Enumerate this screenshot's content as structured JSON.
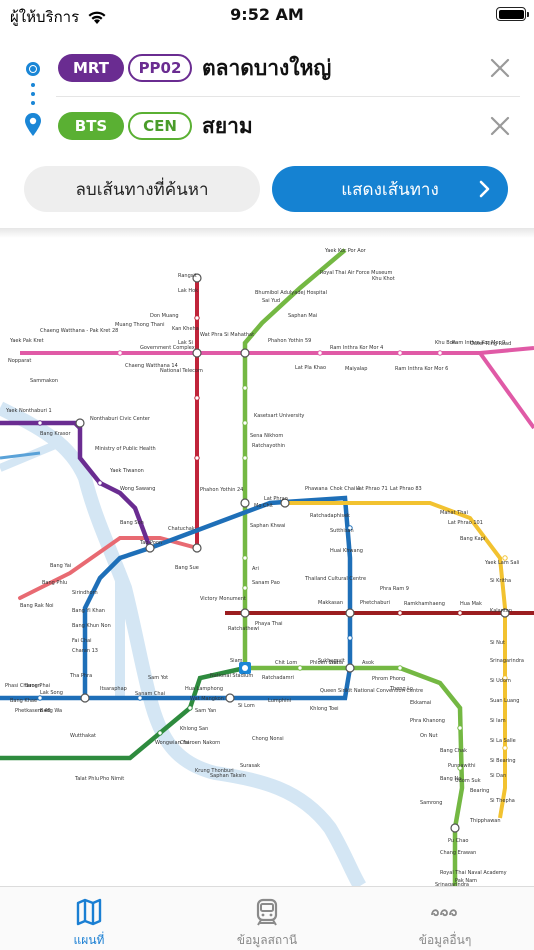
{
  "status": {
    "carrier": "ผู้ให้บริการ",
    "time": "9:52 AM"
  },
  "route": {
    "origin": {
      "line": "MRT",
      "station_code": "PP02",
      "station_name": "ตลาดบางใหญ่",
      "color": "#6a2c91"
    },
    "destination": {
      "line": "BTS",
      "station_code": "CEN",
      "station_name": "สยาม",
      "color": "#5ab033"
    }
  },
  "actions": {
    "reset_label": "ลบเส้นทางที่ค้นหา",
    "show_label": "แสดงเส้นทาง"
  },
  "tabs": [
    {
      "label": "แผนที่",
      "icon": "map-icon",
      "active": true
    },
    {
      "label": "ข้อมูลสถานี",
      "icon": "train-icon",
      "active": false
    },
    {
      "label": "ข้อมูลอื่นๆ",
      "icon": "more-icon",
      "active": false
    }
  ],
  "map": {
    "colors": {
      "mrt_blue": "#1e6fb8",
      "mrt_purple": "#6a2c91",
      "bts_green": "#74b843",
      "bts_dark_green": "#2e8b3e",
      "airport_link": "#9b1d20",
      "red_line": "#d8323f",
      "pink": "#e05aa6",
      "yellow": "#f2c230",
      "river": "#cfe4f3"
    },
    "labels": [
      "Rangsit",
      "Lak Hok",
      "Don Muang",
      "Kan Kheha",
      "Lak Si",
      "Wat Phra Si Mahathat",
      "Phahon Yothin 59",
      "Saphan Mai",
      "Sai Yud",
      "Royal Thai Air Force Museum",
      "Bhumibol Adulyadej Hospital",
      "Yaek Kor Por Aor",
      "Khu Khot",
      "Yaek Pak Kret",
      "Chaeng Watthana - Pak Kret 28",
      "Muang Thong Thani",
      "Chaeng Watthana 14",
      "National Telecom",
      "Government Complex",
      "Ram Inthra Kor Mor 4",
      "Lat Pla Khao",
      "Maiyalap",
      "Ram Inthra Kor Mor 6",
      "Ram Inthra Kor Mor 9",
      "Khu Bon",
      "Outer Ring Road",
      "Nopparat",
      "Sammakon",
      "Yaek Nonthaburi 1",
      "Bang Krasor",
      "Nonthaburi Civic Center",
      "Ministry of Public Health",
      "Yaek Tiwanon",
      "Wong Sawang",
      "Bang Son",
      "Chatuchak",
      "Bang Sue",
      "Tao Poon",
      "Phahon Yothin 24",
      "Ratchayothin",
      "Sena Nikhom",
      "Kasetsart University",
      "Mo Chit",
      "Saphan Khwai",
      "Ari",
      "Sanam Pao",
      "Victory Monument",
      "Phaya Thai",
      "Ratchathewi",
      "Siam",
      "National Stadium",
      "Ratchadamri",
      "Hua Lamphong",
      "Sam Yan",
      "Si Lom",
      "Lumphini",
      "Khlong Toei",
      "Phetchaburi",
      "Makkasan",
      "Ramkhamhaeng",
      "Hua Mak",
      "Phra Ram 9",
      "Thailand Cultural Centre",
      "Huai Khwang",
      "Sutthisan",
      "Ratchadaphisek",
      "Lat Phrao",
      "Phawana",
      "Chok Chai 4",
      "Lat Phrao 71",
      "Lat Phrao 83",
      "Mahat Thai",
      "Lat Phrao 101",
      "Bang Kapi",
      "Yaek Lam Sali",
      "Si Kritha",
      "Kalantan",
      "Si Nut",
      "Srinagarindra",
      "Si Udom",
      "Suan Luang",
      "Si Iam",
      "Si La Salle",
      "Si Bearing",
      "Bearing",
      "Samrong",
      "Pu Chao",
      "Chang Erawan",
      "Royal Thai Naval Academy",
      "Pak Nam",
      "Srinagarindra",
      "Thipphawan",
      "Si Thepha",
      "Si Dan",
      "Phrom Phong",
      "Thong Lo",
      "Ekkamai",
      "Phra Khanong",
      "On Nut",
      "Bang Chak",
      "Punnawithi",
      "Udom Suk",
      "Bang Na",
      "Bang Phlu",
      "Bang Rak Noi",
      "Bang Yai",
      "Sirindhorn",
      "Bang Yi Khan",
      "Bang Khun Non",
      "Fai Chai",
      "Charan 13",
      "Tha Phra",
      "Bang Phai",
      "Bang Wa",
      "Phetkasem 48",
      "Phasi Charoen",
      "Bang Khae",
      "Lak Song",
      "Itsaraphap",
      "Sanam Chai",
      "Sam Yot",
      "Wongwian Yai",
      "Krung Thonburi",
      "Saphan Taksin",
      "Surasak",
      "Chong Nonsi",
      "Wutthakat",
      "Talat Phlu",
      "Pho Nimit",
      "Khlong San",
      "Charoen Nakorn",
      "Sukhumvit",
      "Queen Sirikit National Convention Centre",
      "Wat Mangkon",
      "Chit Lom",
      "Phloen Chit",
      "Nana",
      "Asok"
    ]
  }
}
